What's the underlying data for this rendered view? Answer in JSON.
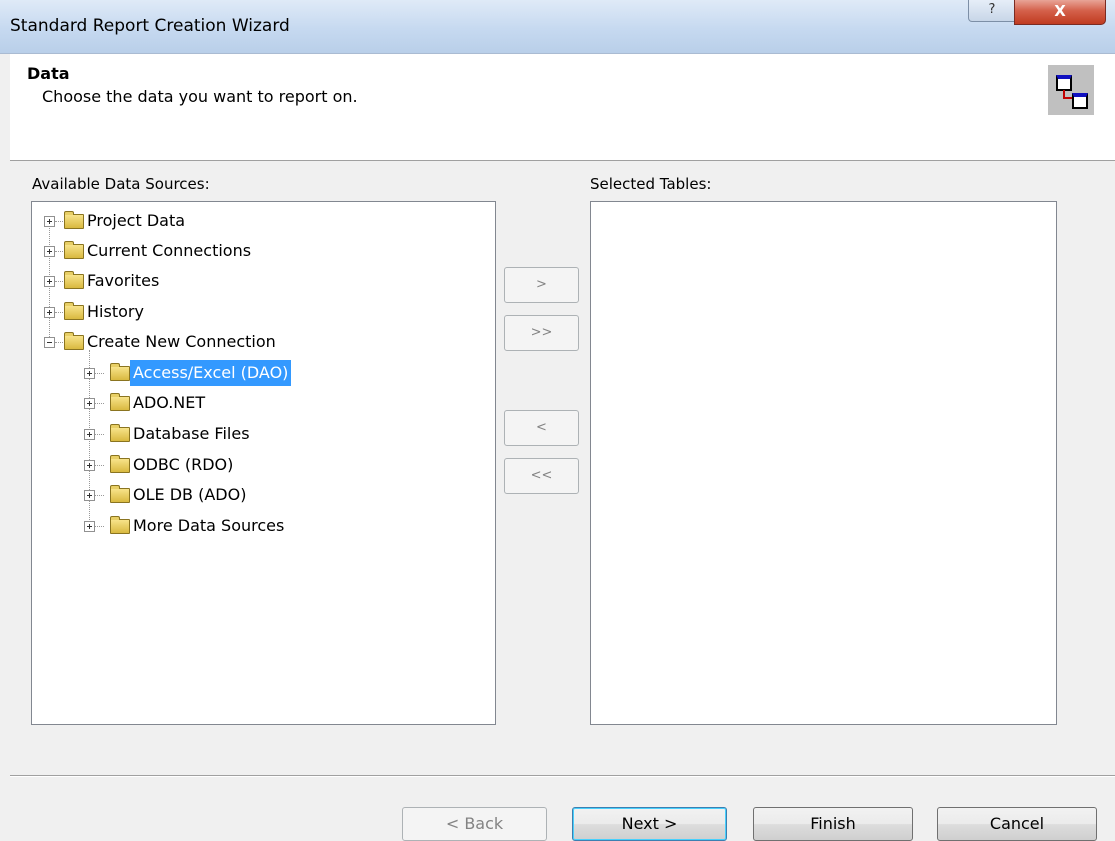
{
  "window": {
    "title": "Standard Report Creation Wizard",
    "help_label": "?",
    "close_label": "X"
  },
  "header": {
    "title": "Data",
    "subtitle": "Choose the data you want to report on."
  },
  "available": {
    "label": "Available Data Sources:",
    "items": [
      {
        "label": "Project Data",
        "expanded": false
      },
      {
        "label": "Current Connections",
        "expanded": false
      },
      {
        "label": "Favorites",
        "expanded": false
      },
      {
        "label": "History",
        "expanded": false
      },
      {
        "label": "Create New Connection",
        "expanded": true
      },
      {
        "label": "Access/Excel (DAO)",
        "selected": true
      },
      {
        "label": "ADO.NET"
      },
      {
        "label": "Database Files"
      },
      {
        "label": "ODBC (RDO)"
      },
      {
        "label": "OLE DB (ADO)"
      },
      {
        "label": "More Data Sources"
      }
    ]
  },
  "selected": {
    "label": "Selected Tables:"
  },
  "transfer": {
    "add": ">",
    "add_all": ">>",
    "remove": "<",
    "remove_all": "<<"
  },
  "footer": {
    "back": "< Back",
    "next": "Next >",
    "finish": "Finish",
    "cancel": "Cancel"
  }
}
